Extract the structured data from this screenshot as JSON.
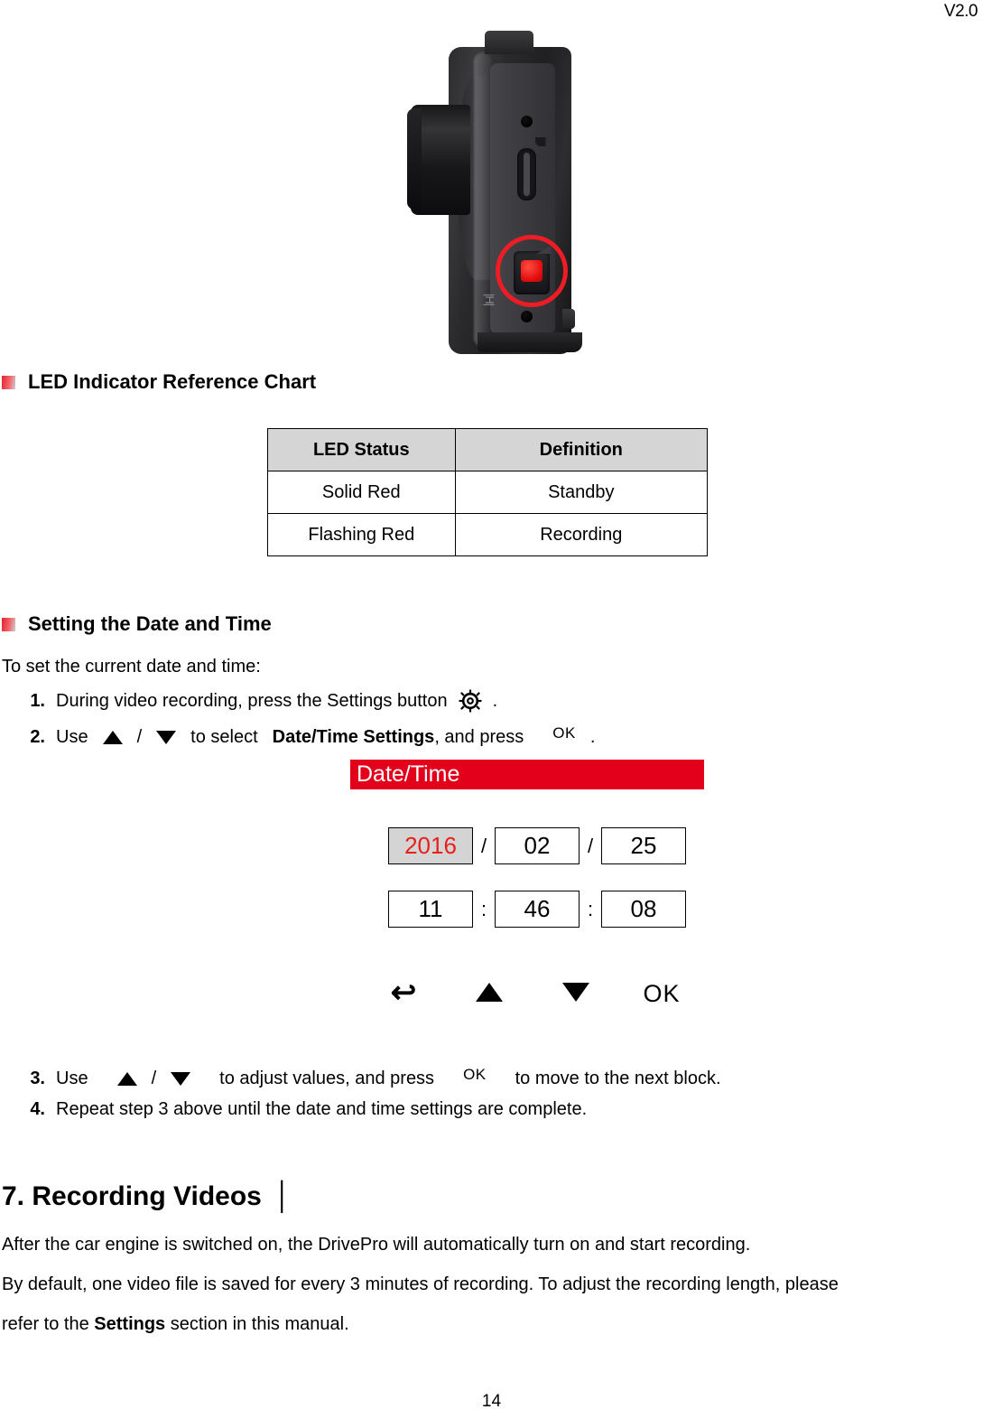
{
  "document": {
    "version_label": "V2.0",
    "page_number": "14"
  },
  "figure": {
    "caption_alt": "dashcam-side-view",
    "annotation": "red-circle-highlight",
    "led_color": "#e60f0f",
    "annotation_color": "#ee1c24"
  },
  "sections": {
    "led_chart": {
      "heading": "LED Indicator Reference Chart",
      "table": {
        "headers": [
          "LED Status",
          "Definition"
        ],
        "rows": [
          [
            "Solid Red",
            "Standby"
          ],
          [
            "Flashing Red",
            "Recording"
          ]
        ]
      }
    },
    "date_time": {
      "heading": "Setting the Date and Time",
      "intro": "To set the current date and time:",
      "steps": [
        {
          "num": "1.",
          "text_before": "During video recording, press the Settings button",
          "icon": "gear-icon",
          "text_after": "."
        },
        {
          "num": "2.",
          "text_before": "Use",
          "icon_up": "triangle-up-icon",
          "separator": "/",
          "icon_down": "triangle-down-icon",
          "text_mid": "to select",
          "bold_text": "Date/Time Settings",
          "text_mid2": ", and press",
          "icon_ok": "OK",
          "text_after": "."
        },
        {
          "num": "3.",
          "text_before": "Use",
          "icon_up": "triangle-up-icon",
          "separator": "/",
          "icon_down": "triangle-down-icon",
          "text_mid": "to adjust values, and press",
          "icon_ok": "OK",
          "text_after": "to move to the next block."
        },
        {
          "num": "4.",
          "text": "Repeat step 3 above until the date and time settings are complete."
        }
      ],
      "screen": {
        "title": "Date/Time",
        "title_bg": "#e3001b",
        "date": {
          "year": "2016",
          "sep1": "/",
          "month": "02",
          "sep2": "/",
          "day": "25",
          "selected_field": "year",
          "selected_text_color": "#e8201d",
          "selected_bg_color": "#d4d4d4"
        },
        "time": {
          "hour": "11",
          "sep1": ":",
          "minute": "46",
          "sep2": ":",
          "second": "08"
        },
        "buttons": [
          "back-arrow-icon",
          "triangle-up-icon",
          "triangle-down-icon",
          "OK"
        ]
      }
    },
    "recording": {
      "heading": "7. Recording Videos",
      "heading_pipe": "│",
      "paragraphs": [
        "After the car engine is switched on, the DrivePro will automatically turn on and start recording.",
        {
          "part1": "By default, one video file is saved for every 3 minutes of recording. To adjust the recording length, please",
          "part2_before": "refer to the",
          "part2_bold": "Settings",
          "part2_after": "section in this manual."
        }
      ]
    }
  }
}
